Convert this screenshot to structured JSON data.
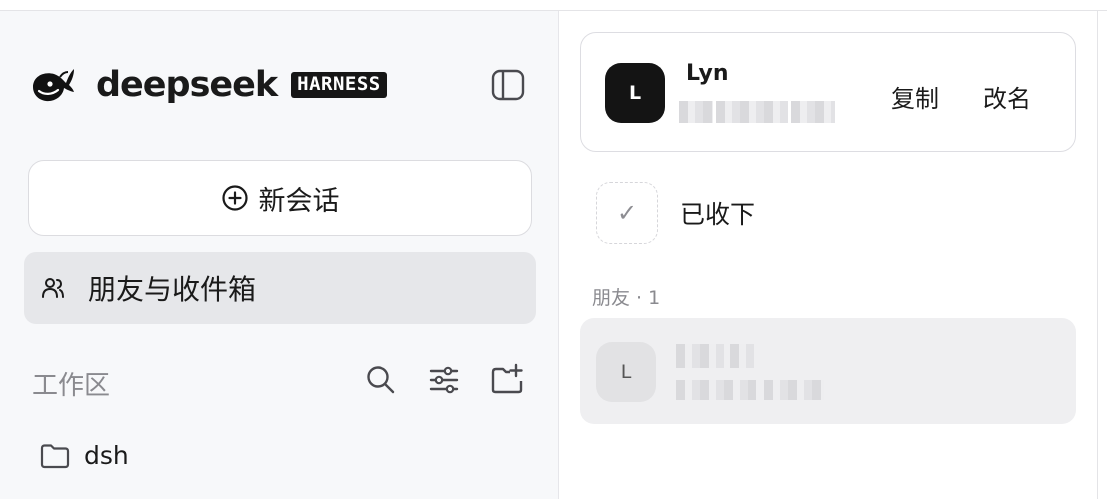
{
  "brand": {
    "wordmark": "deepseek",
    "tag": "HARNESS",
    "accent_color": "#161616"
  },
  "sidebar": {
    "new_chat_label": "新会话",
    "friends_inbox_label": "朋友与收件箱",
    "workspace_title": "工作区",
    "workspace_tools": [
      "search-icon",
      "filter-sliders-icon",
      "new-folder-icon"
    ],
    "folders": [
      {
        "name": "dsh",
        "icon": "folder-icon"
      }
    ]
  },
  "profile": {
    "avatar_letter": "L",
    "name": "Lyn",
    "copy_label": "复制",
    "rename_label": "改名"
  },
  "received": {
    "check_glyph": "✓",
    "label": "已收下"
  },
  "friends": {
    "heading": "朋友 · 1",
    "items": [
      {
        "avatar_letter": "L"
      }
    ]
  }
}
